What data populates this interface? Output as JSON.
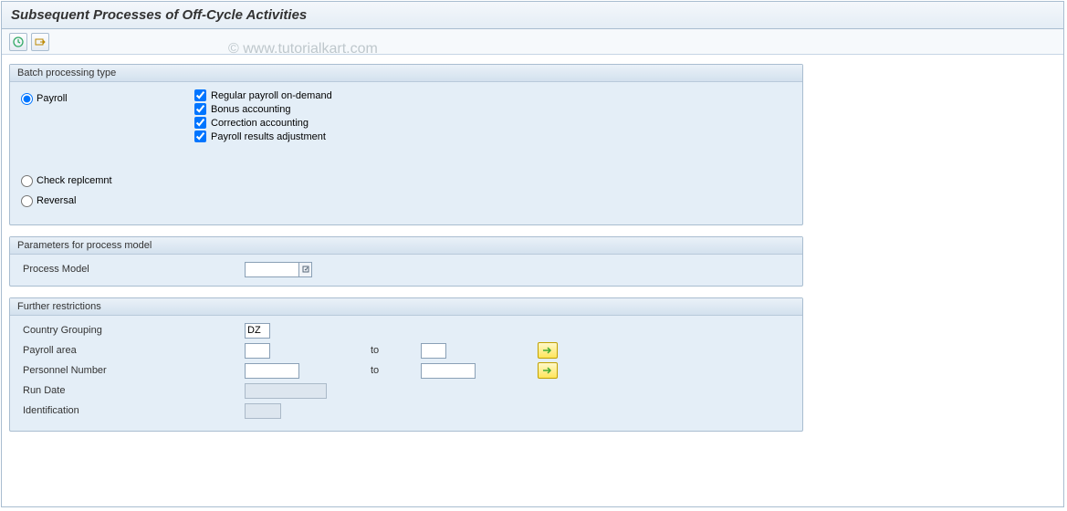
{
  "title": "Subsequent Processes of Off-Cycle Activities",
  "watermark": "© www.tutorialkart.com",
  "groups": {
    "batch": {
      "title": "Batch processing type",
      "radios": {
        "payroll": "Payroll",
        "check_repl": "Check replcemnt",
        "reversal": "Reversal"
      },
      "checks": {
        "regular": "Regular payroll on-demand",
        "bonus": "Bonus accounting",
        "correction": "Correction accounting",
        "adjustment": "Payroll results adjustment"
      }
    },
    "params": {
      "title": "Parameters for process model",
      "process_model_label": "Process Model",
      "process_model_value": ""
    },
    "restrictions": {
      "title": "Further restrictions",
      "country_label": "Country Grouping",
      "country_value": "DZ",
      "payroll_area_label": "Payroll area",
      "personnel_label": "Personnel Number",
      "run_date_label": "Run Date",
      "identification_label": "Identification",
      "to_label": "to"
    }
  }
}
